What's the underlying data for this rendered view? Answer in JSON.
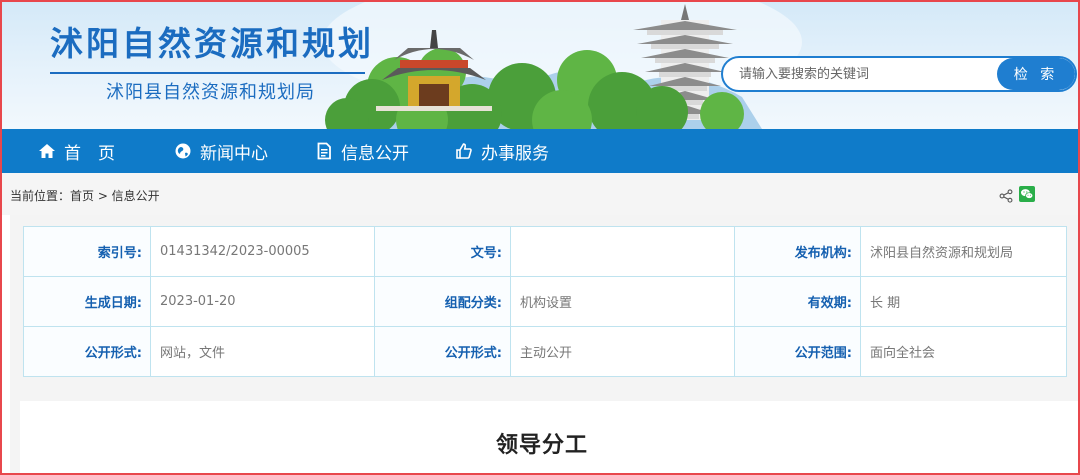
{
  "header": {
    "site_title": "沭阳自然资源和规划",
    "site_subtitle": "沭阳县自然资源和规划局"
  },
  "search": {
    "placeholder": "请输入要搜索的关键词",
    "button_label": "检 索"
  },
  "nav": {
    "items": [
      {
        "label": "首　页",
        "icon": "home-icon"
      },
      {
        "label": "新闻中心",
        "icon": "globe-icon"
      },
      {
        "label": "信息公开",
        "icon": "document-icon"
      },
      {
        "label": "办事服务",
        "icon": "thumbs-up-icon"
      }
    ]
  },
  "breadcrumb": {
    "text": "当前位置：首页 > 信息公开"
  },
  "info": {
    "rows": [
      [
        {
          "label": "索引号:",
          "value": "01431342/2023-00005"
        },
        {
          "label": "文号:",
          "value": ""
        },
        {
          "label": "发布机构:",
          "value": "沭阳县自然资源和规划局"
        }
      ],
      [
        {
          "label": "生成日期:",
          "value": "2023-01-20"
        },
        {
          "label": "组配分类:",
          "value": "机构设置"
        },
        {
          "label": "有效期:",
          "value": "长 期"
        }
      ],
      [
        {
          "label": "公开形式:",
          "value": "网站，文件"
        },
        {
          "label": "公开形式:",
          "value": "主动公开"
        },
        {
          "label": "公开范围:",
          "value": "面向全社会"
        }
      ]
    ]
  },
  "article": {
    "title": "领导分工"
  },
  "colors": {
    "primary_blue": "#0f7bc9",
    "title_blue": "#1b6cc0",
    "frame_red": "#e8474c",
    "label_blue": "#1560b0",
    "table_border": "#bfe3ef"
  }
}
